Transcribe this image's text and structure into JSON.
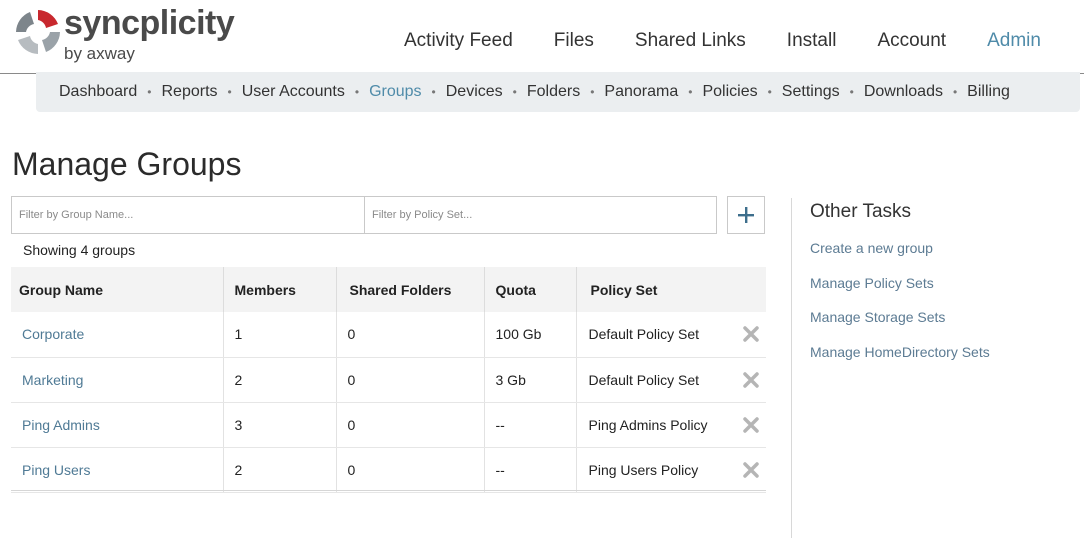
{
  "brand": {
    "name": "syncplicity",
    "subtitle": "by axway"
  },
  "main_nav": {
    "items": [
      "Activity Feed",
      "Files",
      "Shared Links",
      "Install",
      "Account",
      "Admin"
    ],
    "active": "Admin"
  },
  "sub_nav": {
    "items": [
      "Dashboard",
      "Reports",
      "User Accounts",
      "Groups",
      "Devices",
      "Folders",
      "Panorama",
      "Policies",
      "Settings",
      "Downloads",
      "Billing"
    ],
    "active": "Groups"
  },
  "page": {
    "title": "Manage Groups"
  },
  "filters": {
    "group_name_placeholder": "Filter by Group Name...",
    "policy_set_placeholder": "Filter by Policy Set...",
    "add_icon": "plus-icon"
  },
  "table": {
    "showing_text": "Showing 4 groups",
    "headers": {
      "group_name": "Group Name",
      "members": "Members",
      "shared_folders": "Shared Folders",
      "quota": "Quota",
      "policy_set": "Policy Set"
    },
    "rows": [
      {
        "group_name": "Corporate",
        "members": "1",
        "shared_folders": "0",
        "quota": "100 Gb",
        "policy_set": "Default Policy Set"
      },
      {
        "group_name": "Marketing",
        "members": "2",
        "shared_folders": "0",
        "quota": "3 Gb",
        "policy_set": "Default Policy Set"
      },
      {
        "group_name": "Ping Admins",
        "members": "3",
        "shared_folders": "0",
        "quota": "--",
        "policy_set": "Ping Admins Policy"
      },
      {
        "group_name": "Ping Users",
        "members": "2",
        "shared_folders": "0",
        "quota": "--",
        "policy_set": "Ping Users Policy"
      }
    ],
    "delete_icon": "close-x-icon"
  },
  "other_tasks": {
    "title": "Other Tasks",
    "links": [
      "Create a new group",
      "Manage Policy Sets",
      "Manage Storage Sets",
      "Manage HomeDirectory Sets"
    ]
  },
  "colors": {
    "accent": "#4f8ba9",
    "link": "#4f7a95",
    "subnav_bg": "#ebeef0",
    "table_header_bg": "#f3f3f3",
    "logo_red": "#c8282e",
    "logo_gray": "#9aa2a8"
  }
}
